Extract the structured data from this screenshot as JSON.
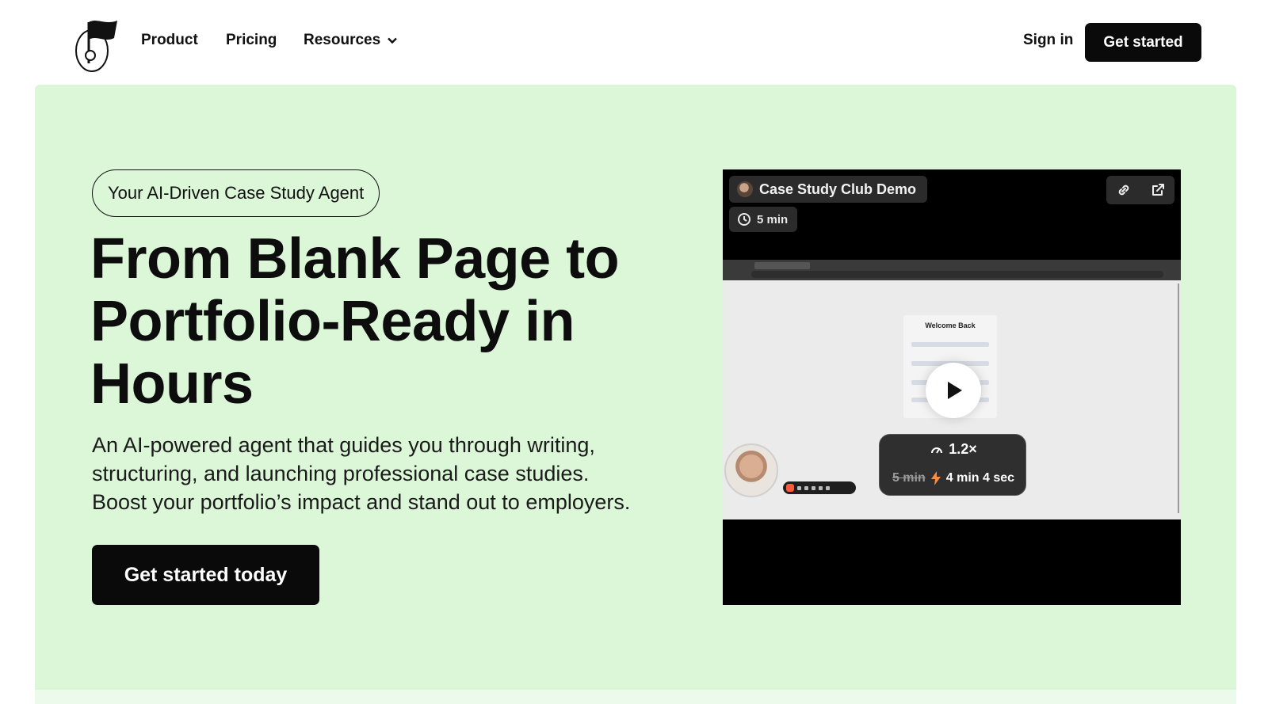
{
  "nav": {
    "product": "Product",
    "pricing": "Pricing",
    "resources": "Resources",
    "sign_in": "Sign in",
    "get_started": "Get started"
  },
  "hero": {
    "badge": "Your AI-Driven Case Study Agent",
    "headline_line1": "From Blank Page to",
    "headline_line2": "Portfolio-Ready in",
    "headline_line3": "Hours",
    "sub_line1": "An AI-powered agent that guides you through writing,",
    "sub_line2": "structuring, and launching professional case studies.",
    "sub_line3": "Boost your portfolio’s impact and stand out to employers.",
    "cta": "Get started today"
  },
  "video": {
    "title": "Case Study Club Demo",
    "duration": "5 min",
    "screen_heading": "Welcome Back",
    "speed": "1.2×",
    "original_time": "5 min",
    "new_time": "4 min 4 sec"
  },
  "colors": {
    "hero_bg": "#dbf7d8",
    "button_bg": "#0a0a0a",
    "accent_orange": "#ff5b3a"
  },
  "icons": [
    "flag-logo-icon",
    "chevron-down-icon",
    "clock-icon",
    "link-icon",
    "external-link-icon",
    "play-icon",
    "speedometer-icon",
    "bolt-icon"
  ]
}
